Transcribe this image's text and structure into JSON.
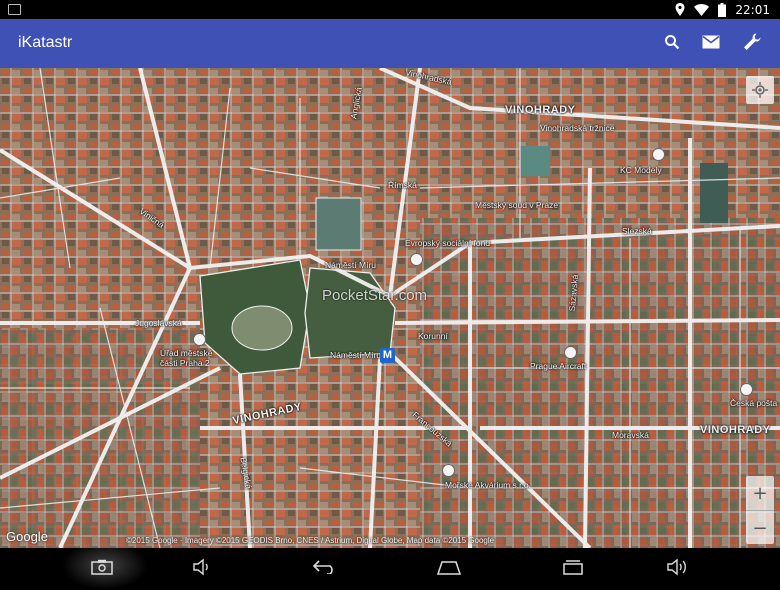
{
  "status_bar": {
    "time": "22:01",
    "icons": [
      "notification-icon",
      "location-icon",
      "wifi-icon",
      "battery-icon"
    ]
  },
  "app_bar": {
    "title": "iKatastr",
    "actions": [
      {
        "name": "search-icon",
        "interactable": true
      },
      {
        "name": "mail-icon",
        "interactable": true
      },
      {
        "name": "wrench-icon",
        "interactable": true
      }
    ],
    "color": "#3f51b5"
  },
  "map": {
    "labels": {
      "vinohradska_top": "Vinohradská",
      "vinohrady_top": "VINOHRADY",
      "vinohradska_trznice": "Vinohradská tržnice",
      "anglicka": "Anglická",
      "kc_modely": "KC Modely",
      "rimska": "Římská",
      "mestsky_soud": "Městský soud v Praze",
      "slezska": "Slezská",
      "evropsky_soc_fond": "Evropský sociální fond",
      "vinicna": "Viničná",
      "namesti_miru_top": "Náměstí Míru",
      "jugoslavska": "Jugoslávská",
      "urad_mestske_casti": "Úřad městské části Praha 2",
      "sazavska": "Sázavská",
      "korunni": "Korunní",
      "namesti_miru": "Náměstí Míru",
      "prague_aircraft": "Prague Aircraft",
      "ceska_posta": "Česká pošta",
      "vinohrady_bottom": "VINOHRADY",
      "francouzska": "Francouzská",
      "moravska": "Moravská",
      "vinohrady_right": "VINOHRADY",
      "morske_akvarium": "Mořské Akvárium s.r.o.",
      "belgicka": "Belgická"
    },
    "watermark": "PocketStar.com",
    "google": "Google",
    "copyright": "©2015 Google · Imagery ©2015 GEODIS Brno, CNES / Astrium, Digital Globe, Map data ©2015 Google",
    "controls": {
      "locate": "my-location-icon",
      "zoom_in": "+",
      "zoom_out": "−"
    }
  },
  "nav_bar": {
    "buttons": [
      "screenshot-icon",
      "volume-down-icon",
      "back-icon",
      "home-icon",
      "recents-icon",
      "volume-up-icon"
    ]
  }
}
